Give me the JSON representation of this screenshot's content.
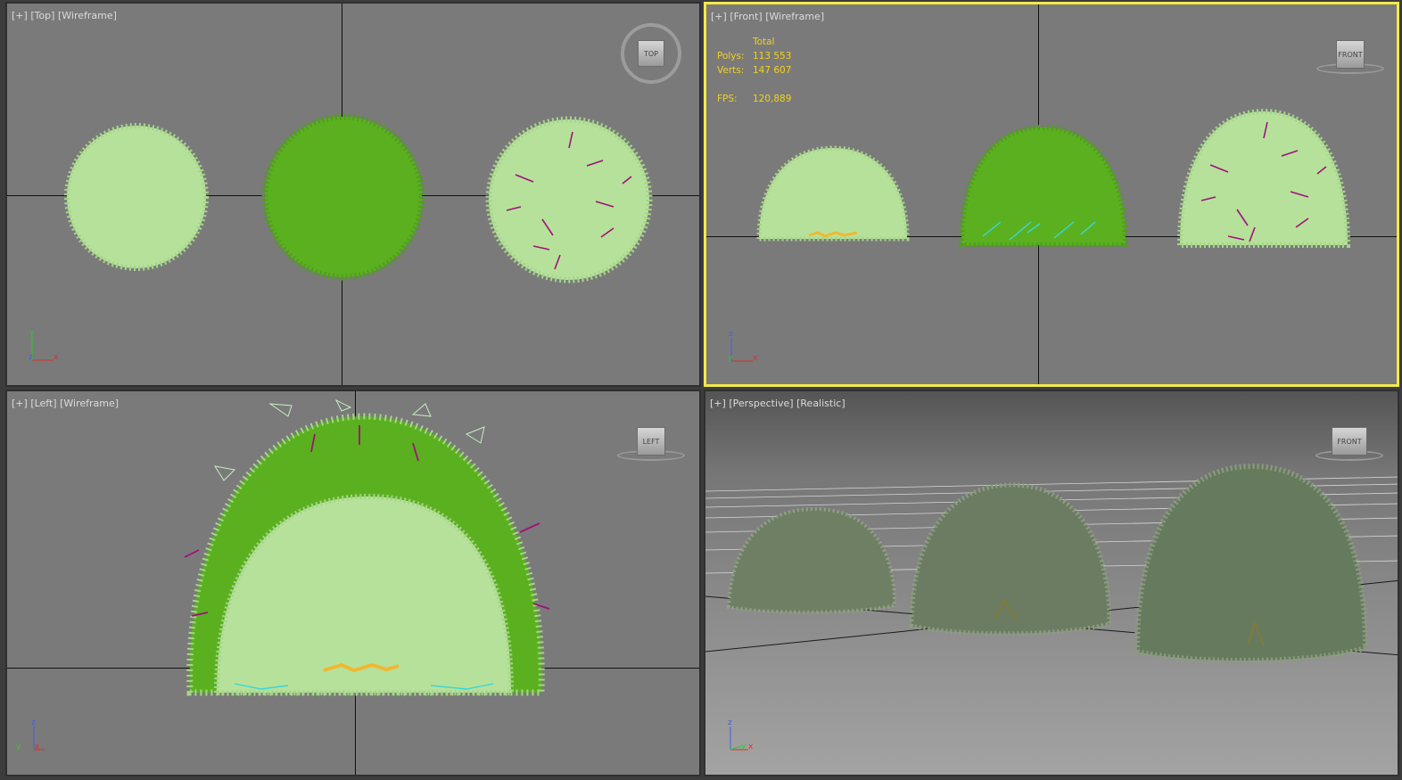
{
  "viewports": {
    "top": {
      "plus": "[+]",
      "view": "[Top]",
      "mode": "[Wireframe]",
      "cube": "TOP",
      "axes": {
        "up": "y",
        "right": "x",
        "corner": "z"
      }
    },
    "front": {
      "plus": "[+]",
      "view": "[Front]",
      "mode": "[Wireframe]",
      "cube": "FRONT",
      "axes": {
        "up": "z",
        "right": "x",
        "corner": "y"
      }
    },
    "left": {
      "plus": "[+]",
      "view": "[Left]",
      "mode": "[Wireframe]",
      "cube": "LEFT",
      "axes": {
        "up": "z",
        "right": "x",
        "corner": "y"
      }
    },
    "persp": {
      "plus": "[+]",
      "view": "[Perspective]",
      "mode": "[Realistic]",
      "cube": "FRONT",
      "axes": {
        "up": "z",
        "right": "x",
        "corner": "y"
      }
    }
  },
  "stats": {
    "header": "Total",
    "polys_label": "Polys:",
    "polys": "113 553",
    "verts_label": "Verts:",
    "verts": "147 607",
    "fps_label": "FPS:",
    "fps": "120,889"
  },
  "colors": {
    "active_border": "#f2e94a",
    "viewport_bg": "#7a7a7a",
    "light_green": "#b6e19a",
    "dark_green": "#5bb020",
    "stat_text": "#f2d21e",
    "magenta": "#a0107a"
  }
}
